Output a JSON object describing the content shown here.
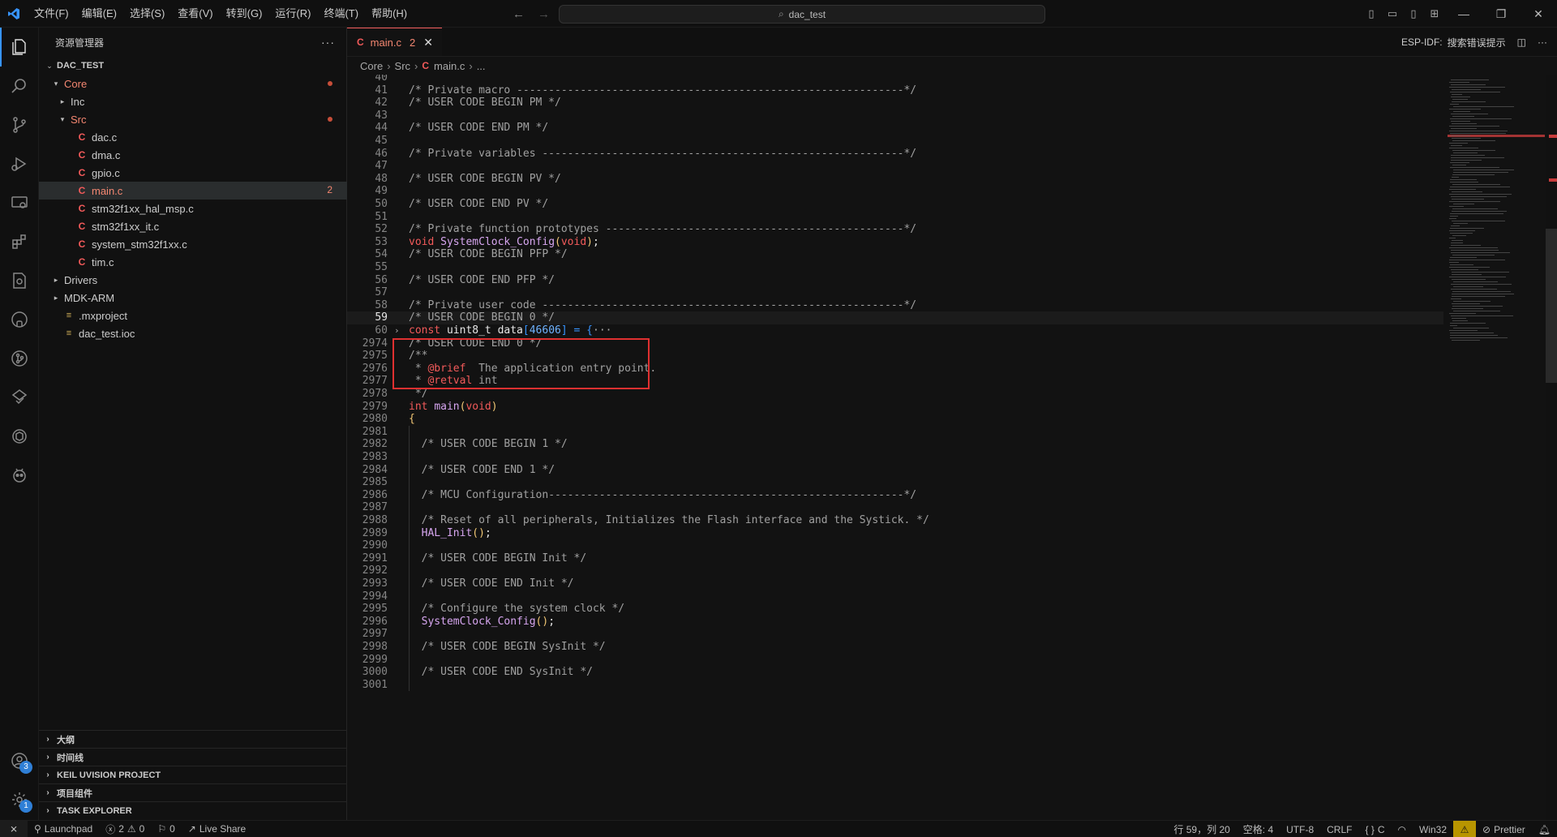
{
  "menu": [
    "文件(F)",
    "编辑(E)",
    "选择(S)",
    "查看(V)",
    "转到(G)",
    "运行(R)",
    "终端(T)",
    "帮助(H)"
  ],
  "search": {
    "text": "dac_test"
  },
  "sidebar": {
    "title": "资源管理器",
    "more": "···",
    "root": "DAC_TEST",
    "items": [
      {
        "label": "Core",
        "kind": "folder-open",
        "depth": 1,
        "modified": true
      },
      {
        "label": "Inc",
        "kind": "folder",
        "depth": 2
      },
      {
        "label": "Src",
        "kind": "folder-open",
        "depth": 2,
        "modified": true
      },
      {
        "label": "dac.c",
        "kind": "c",
        "depth": 3
      },
      {
        "label": "dma.c",
        "kind": "c",
        "depth": 3
      },
      {
        "label": "gpio.c",
        "kind": "c",
        "depth": 3
      },
      {
        "label": "main.c",
        "kind": "c",
        "depth": 3,
        "selected": true,
        "problems": "2"
      },
      {
        "label": "stm32f1xx_hal_msp.c",
        "kind": "c",
        "depth": 3
      },
      {
        "label": "stm32f1xx_it.c",
        "kind": "c",
        "depth": 3
      },
      {
        "label": "system_stm32f1xx.c",
        "kind": "c",
        "depth": 3
      },
      {
        "label": "tim.c",
        "kind": "c",
        "depth": 3
      },
      {
        "label": "Drivers",
        "kind": "folder",
        "depth": 1
      },
      {
        "label": "MDK-ARM",
        "kind": "folder",
        "depth": 1
      },
      {
        "label": ".mxproject",
        "kind": "ioc",
        "depth": 1
      },
      {
        "label": "dac_test.ioc",
        "kind": "ioc",
        "depth": 1
      }
    ],
    "panels": [
      "大纲",
      "时间线",
      "KEIL UVISION PROJECT",
      "项目组件",
      "TASK EXPLORER"
    ]
  },
  "activity_badges": {
    "accounts": "3",
    "manage": "1"
  },
  "editor": {
    "tab": {
      "label": "main.c",
      "count": "2",
      "close": "✕"
    },
    "tab_right": {
      "espidf": "ESP-IDF:",
      "search_errors": "搜索错误提示"
    },
    "breadcrumb": [
      "Core",
      "Src",
      "main.c",
      "..."
    ],
    "lines": [
      {
        "n": "40",
        "t": ""
      },
      {
        "n": "41",
        "t": "/* Private macro -------------------------------------------------------------*/"
      },
      {
        "n": "42",
        "t": "/* USER CODE BEGIN PM */"
      },
      {
        "n": "43",
        "t": ""
      },
      {
        "n": "44",
        "t": "/* USER CODE END PM */"
      },
      {
        "n": "45",
        "t": ""
      },
      {
        "n": "46",
        "t": "/* Private variables ---------------------------------------------------------*/"
      },
      {
        "n": "47",
        "t": ""
      },
      {
        "n": "48",
        "t": "/* USER CODE BEGIN PV */"
      },
      {
        "n": "49",
        "t": ""
      },
      {
        "n": "50",
        "t": "/* USER CODE END PV */"
      },
      {
        "n": "51",
        "t": ""
      },
      {
        "n": "52",
        "t": "/* Private function prototypes -----------------------------------------------*/"
      },
      {
        "n": "53",
        "t": "void SystemClock_Config(void);"
      },
      {
        "n": "54",
        "t": "/* USER CODE BEGIN PFP */"
      },
      {
        "n": "55",
        "t": ""
      },
      {
        "n": "56",
        "t": "/* USER CODE END PFP */"
      },
      {
        "n": "57",
        "t": ""
      },
      {
        "n": "58",
        "t": "/* Private user code ---------------------------------------------------------*/"
      },
      {
        "n": "59",
        "t": "/* USER CODE BEGIN 0 */"
      },
      {
        "n": "60",
        "t": "const uint8_t data[46606] = {···"
      },
      {
        "n": "2974",
        "t": "/* USER CODE END 0 */"
      },
      {
        "n": "2975",
        "t": "/**"
      },
      {
        "n": "2976",
        "t": " * @brief  The application entry point."
      },
      {
        "n": "2977",
        "t": " * @retval int"
      },
      {
        "n": "2978",
        "t": " */"
      },
      {
        "n": "2979",
        "t": "int main(void)"
      },
      {
        "n": "2980",
        "t": "{"
      },
      {
        "n": "2981",
        "t": ""
      },
      {
        "n": "2982",
        "t": "  /* USER CODE BEGIN 1 */"
      },
      {
        "n": "2983",
        "t": ""
      },
      {
        "n": "2984",
        "t": "  /* USER CODE END 1 */"
      },
      {
        "n": "2985",
        "t": ""
      },
      {
        "n": "2986",
        "t": "  /* MCU Configuration--------------------------------------------------------*/"
      },
      {
        "n": "2987",
        "t": ""
      },
      {
        "n": "2988",
        "t": "  /* Reset of all peripherals, Initializes the Flash interface and the Systick. */"
      },
      {
        "n": "2989",
        "t": "  HAL_Init();"
      },
      {
        "n": "2990",
        "t": ""
      },
      {
        "n": "2991",
        "t": "  /* USER CODE BEGIN Init */"
      },
      {
        "n": "2992",
        "t": ""
      },
      {
        "n": "2993",
        "t": "  /* USER CODE END Init */"
      },
      {
        "n": "2994",
        "t": ""
      },
      {
        "n": "2995",
        "t": "  /* Configure the system clock */"
      },
      {
        "n": "2996",
        "t": "  SystemClock_Config();"
      },
      {
        "n": "2997",
        "t": ""
      },
      {
        "n": "2998",
        "t": "  /* USER CODE BEGIN SysInit */"
      },
      {
        "n": "2999",
        "t": ""
      },
      {
        "n": "3000",
        "t": "  /* USER CODE END SysInit */"
      },
      {
        "n": "3001",
        "t": ""
      }
    ],
    "current_line": "59"
  },
  "status": {
    "launchpad": "Launchpad",
    "errors": "2",
    "warnings": "0",
    "ports": "0",
    "liveshare": "Live Share",
    "position": "行 59，列 20",
    "spaces": "空格: 4",
    "encoding": "UTF-8",
    "eol": "CRLF",
    "language": "C",
    "platform": "Win32",
    "prettier": "Prettier"
  },
  "colors": {
    "accent": "#3794ff",
    "error": "#f25a5a",
    "highlight_box": "#e03030"
  }
}
